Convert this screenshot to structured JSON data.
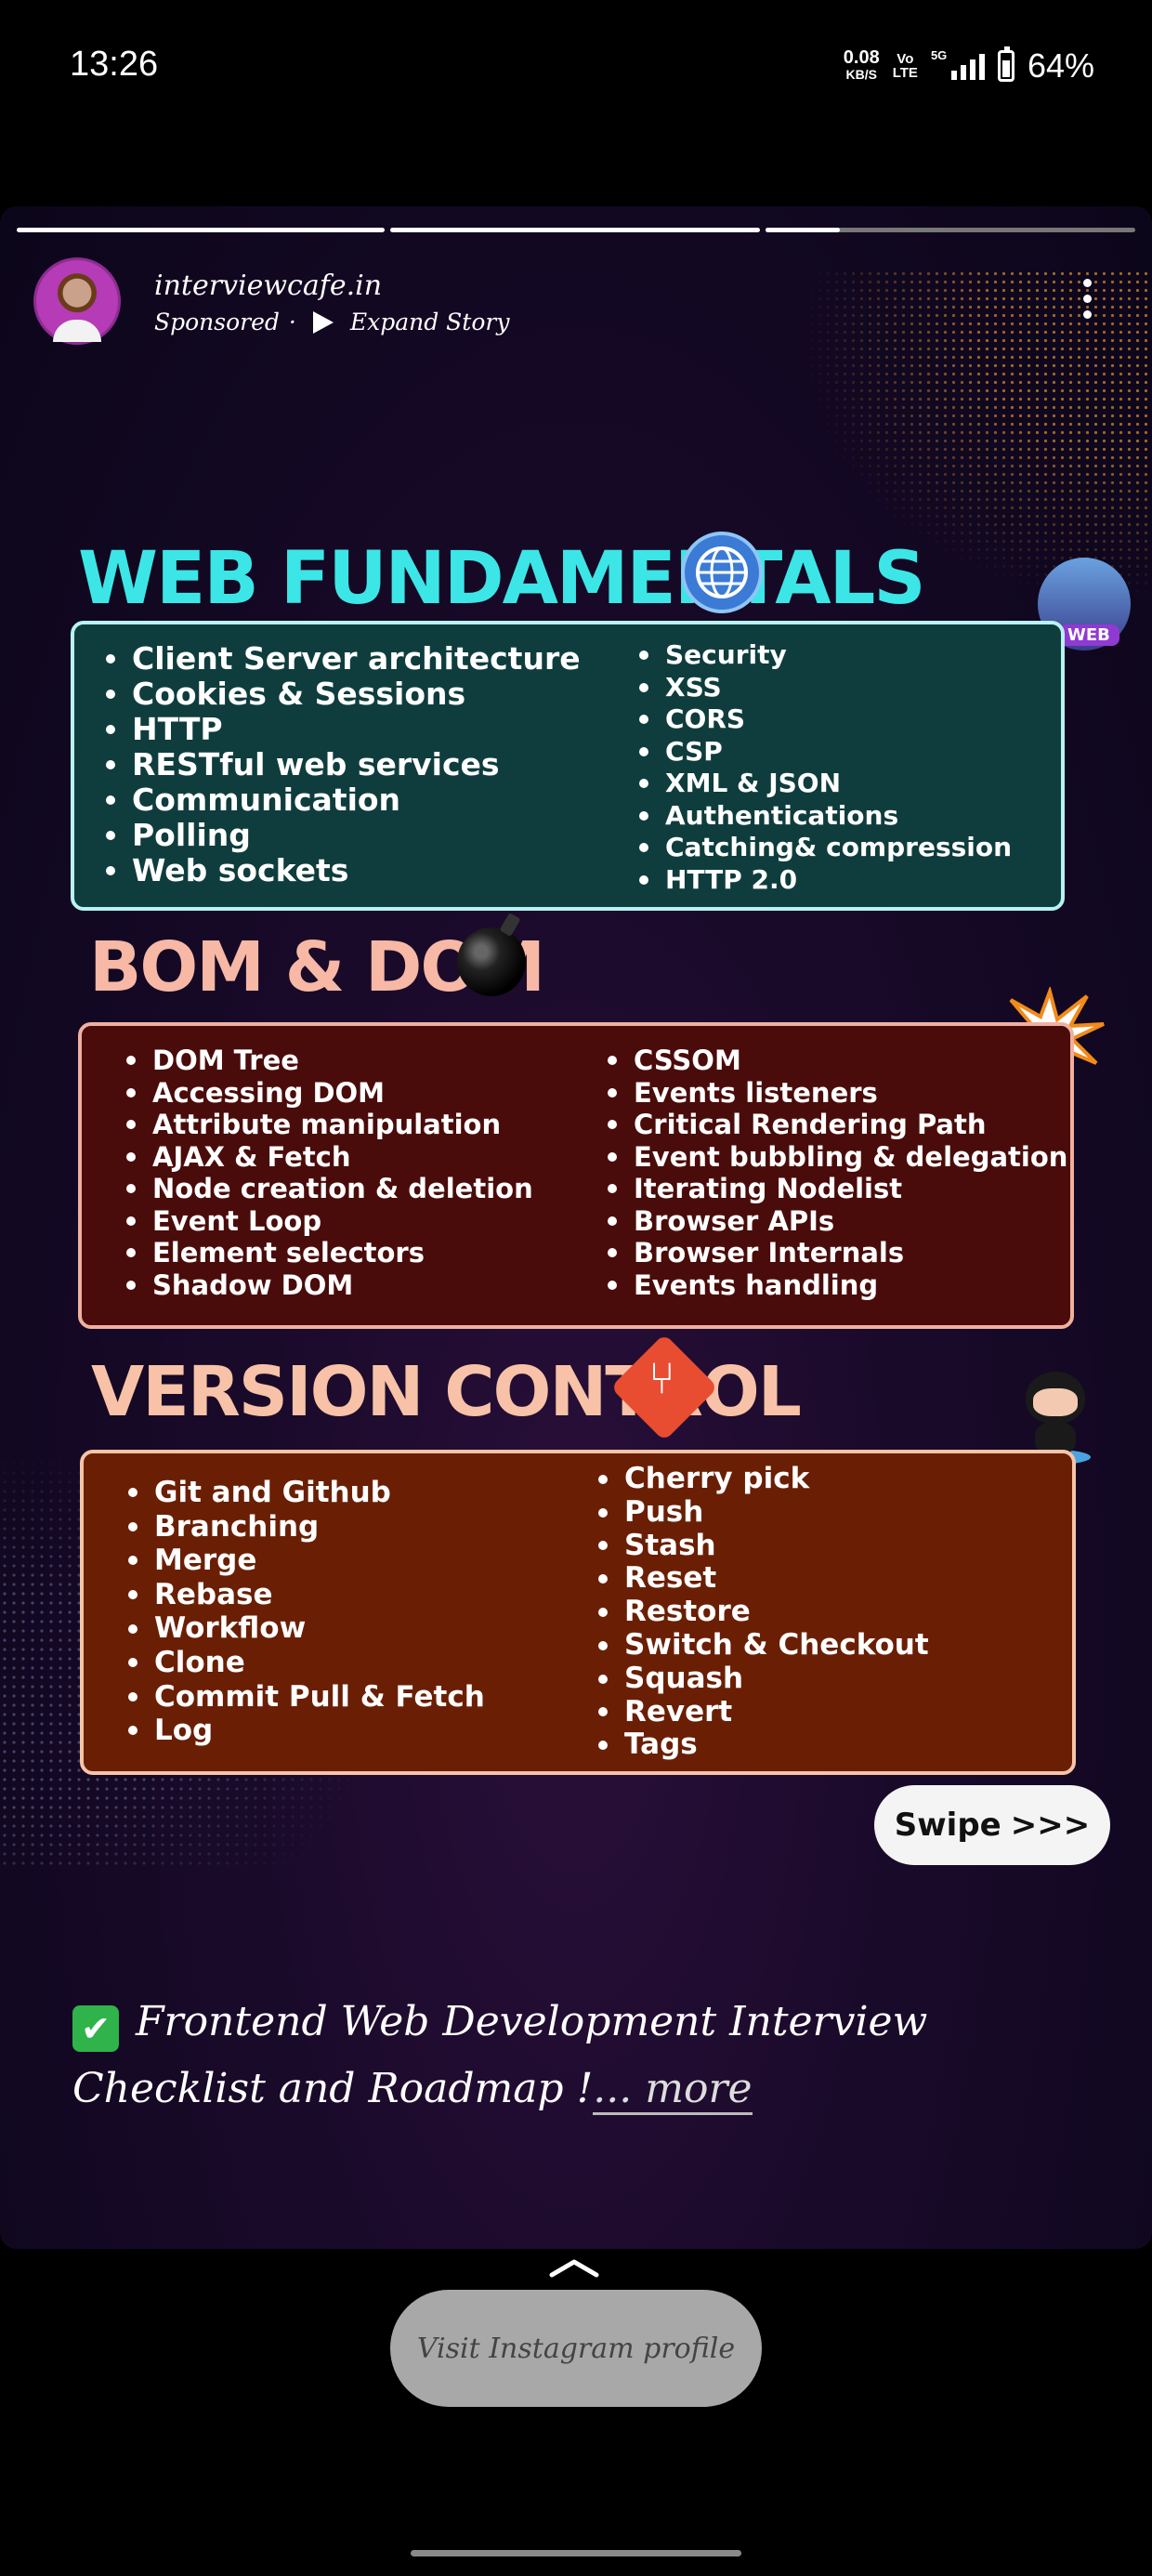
{
  "status_bar": {
    "time": "13:26",
    "net_speed": "0.08",
    "net_speed_unit": "KB/S",
    "volte_top": "Vo",
    "volte_bottom": "LTE",
    "network": "5G",
    "battery_percent": "64%",
    "battery_level": 0.64
  },
  "story": {
    "progress_segments": [
      1,
      1,
      0.2
    ],
    "account_handle": "interviewcafe.in",
    "sponsored_label": "Sponsored",
    "separator": "·",
    "expand_label": "Expand Story"
  },
  "sections": {
    "web": {
      "title": "WEB FUNDAMENTALS",
      "badge_label": "WEB",
      "left_items": [
        "Client Server architecture",
        "Cookies & Sessions",
        "HTTP",
        "RESTful web services",
        "Communication",
        "Polling",
        "Web sockets"
      ],
      "right_items": [
        "Security",
        " XSS",
        "CORS",
        "CSP",
        "XML & JSON",
        "Authentications",
        "Catching& compression",
        " HTTP 2.0"
      ]
    },
    "bom": {
      "title": "BOM & DOM",
      "left_items": [
        "DOM Tree",
        "Accessing DOM",
        "Attribute manipulation",
        "AJAX & Fetch",
        "Node creation & deletion",
        "Event Loop",
        "Element selectors",
        "Shadow DOM"
      ],
      "right_items": [
        "CSSOM",
        "Events listeners",
        "Critical Rendering Path",
        "Event bubbling & delegation",
        "Iterating Nodelist",
        "Browser APIs",
        "Browser Internals",
        "Events handling"
      ]
    },
    "version": {
      "title": "VERSION CONTROL",
      "left_items": [
        "Git and Github",
        "Branching",
        "Merge",
        "Rebase",
        "Workflow",
        "Clone",
        "Commit Pull & Fetch",
        "Log"
      ],
      "right_items": [
        "Cherry pick",
        "Push",
        "Stash",
        "Reset",
        "Restore",
        "Switch & Checkout",
        "Squash",
        "Revert",
        "Tags"
      ]
    }
  },
  "swipe": {
    "label": "Swipe",
    "arrows": ">>>"
  },
  "caption": {
    "check": "✔",
    "text": "Frontend Web Development Interview Checklist and Roadmap !",
    "more": "... more"
  },
  "visit_profile": {
    "label": "Visit Instagram profile"
  },
  "colors": {
    "web_title": "#3ce6e6",
    "bom_title": "#f7b8a6",
    "version_title": "#f7c2a7",
    "web_box": "#0f3d3d",
    "bom_box": "#4a0c0b",
    "version_box": "#6a1f05"
  }
}
